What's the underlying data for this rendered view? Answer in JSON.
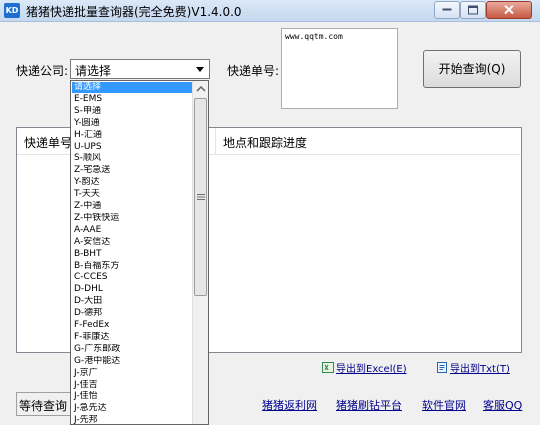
{
  "window": {
    "app_icon_text": "KD",
    "title": "猪猪快递批量查询器(完全免费)V1.4.0.0"
  },
  "form": {
    "company_label": "快递公司:",
    "company_value": "请选择",
    "tracking_label": "快递单号:",
    "tracking_input": "www.qqtm.com",
    "start_button": "开始查询(Q)"
  },
  "grid": {
    "columns": [
      "快递单号",
      "地点和跟踪进度"
    ]
  },
  "export": {
    "excel": "导出到Excel(E)",
    "txt": "导出到Txt(T)"
  },
  "status": {
    "text": "等待查询"
  },
  "footer_links": [
    "猪猪返利网",
    "猪猪刷钻平台",
    "软件官网",
    "客服QQ"
  ],
  "dropdown": {
    "items": [
      "请选择",
      "E-EMS",
      "S-申通",
      "Y-圆通",
      "H-汇通",
      "U-UPS",
      "S-顺风",
      "Z-宅急送",
      "Y-韵达",
      "T-天天",
      "Z-中通",
      "Z-中铁快运",
      "A-AAE",
      "A-安信达",
      "B-BHT",
      "B-百福东方",
      "C-CCES",
      "D-DHL",
      "D-大田",
      "D-德邦",
      "F-FedEx",
      "F-菲康达",
      "G-广东邮政",
      "G-港中能达",
      "J-京广",
      "J-佳吉",
      "J-佳怡",
      "J-急先达",
      "J-先邦"
    ],
    "selected_index": 0,
    "accent": "#3399ff"
  }
}
